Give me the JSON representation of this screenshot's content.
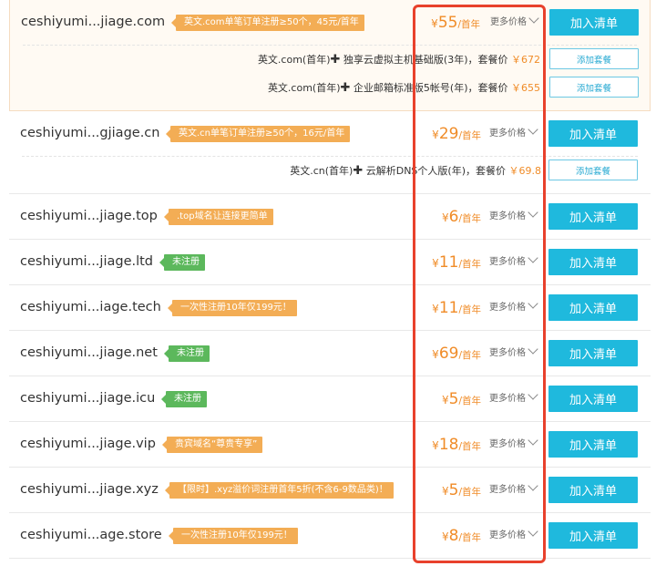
{
  "rows": [
    {
      "domain": "ceshiyumi...jiage.com",
      "tag": "英文.com单笔订单注册≥50个，45元/首年",
      "tag_color": "orange",
      "price_symbol": "¥",
      "price": "55",
      "unit": "/首年",
      "more": "更多价格",
      "add": "加入清单",
      "highlight": true,
      "packages": [
        {
          "item": "英文.com(首年)",
          "plus": "✚",
          "item2": " 独享云虚拟主机基础版(3年)，",
          "label": "套餐价",
          "price": "￥672",
          "btn": "添加套餐"
        },
        {
          "item": "英文.com(首年)",
          "plus": "✚",
          "item2": " 企业邮箱标准版5帐号(年)，",
          "label": "套餐价",
          "price": "￥655",
          "btn": "添加套餐"
        }
      ]
    },
    {
      "domain": "ceshiyumi...gjiage.cn",
      "tag": "英文.cn单笔订单注册≥50个，16元/首年",
      "tag_color": "orange",
      "price_symbol": "¥",
      "price": "29",
      "unit": "/首年",
      "more": "更多价格",
      "add": "加入清单",
      "highlight": false,
      "packages": [
        {
          "item": "英文.cn(首年)",
          "plus": "✚",
          "item2": " 云解析DNS个人版(年)，",
          "label": "套餐价",
          "price": "￥69.8",
          "btn": "添加套餐"
        }
      ]
    },
    {
      "domain": "ceshiyumi...jiage.top",
      "tag": ".top域名让连接更简单",
      "tag_color": "orange",
      "price_symbol": "¥",
      "price": "6",
      "unit": "/首年",
      "more": "更多价格",
      "add": "加入清单",
      "highlight": false,
      "packages": []
    },
    {
      "domain": "ceshiyumi...jiage.ltd",
      "tag": "未注册",
      "tag_color": "green",
      "price_symbol": "¥",
      "price": "11",
      "unit": "/首年",
      "more": "更多价格",
      "add": "加入清单",
      "highlight": false,
      "packages": []
    },
    {
      "domain": "ceshiyumi...iage.tech",
      "tag": "一次性注册10年仅199元！",
      "tag_color": "orange",
      "price_symbol": "¥",
      "price": "11",
      "unit": "/首年",
      "more": "更多价格",
      "add": "加入清单",
      "highlight": false,
      "packages": []
    },
    {
      "domain": "ceshiyumi...jiage.net",
      "tag": "未注册",
      "tag_color": "green",
      "price_symbol": "¥",
      "price": "69",
      "unit": "/首年",
      "more": "更多价格",
      "add": "加入清单",
      "highlight": false,
      "packages": []
    },
    {
      "domain": "ceshiyumi...jiage.icu",
      "tag": "未注册",
      "tag_color": "green",
      "price_symbol": "¥",
      "price": "5",
      "unit": "/首年",
      "more": "更多价格",
      "add": "加入清单",
      "highlight": false,
      "packages": []
    },
    {
      "domain": "ceshiyumi...jiage.vip",
      "tag": "贵宾域名“尊贵专享”",
      "tag_color": "orange",
      "price_symbol": "¥",
      "price": "18",
      "unit": "/首年",
      "more": "更多价格",
      "add": "加入清单",
      "highlight": false,
      "packages": []
    },
    {
      "domain": "ceshiyumi...jiage.xyz",
      "tag": "【限时】.xyz溢价词注册首年5折(不含6-9数品类)！",
      "tag_color": "orange",
      "price_symbol": "¥",
      "price": "5",
      "unit": "/首年",
      "more": "更多价格",
      "add": "加入清单",
      "highlight": false,
      "packages": []
    },
    {
      "domain": "ceshiyumi...age.store",
      "tag": "一次性注册10年仅199元！",
      "tag_color": "orange",
      "price_symbol": "¥",
      "price": "8",
      "unit": "/首年",
      "more": "更多价格",
      "add": "加入清单",
      "highlight": false,
      "packages": []
    }
  ],
  "colors": {
    "accent_button": "#1fb9dd",
    "price": "#f08c28",
    "tag_orange": "#f3ad55",
    "tag_green": "#5cb85c",
    "annotation_box": "#e8412c"
  }
}
